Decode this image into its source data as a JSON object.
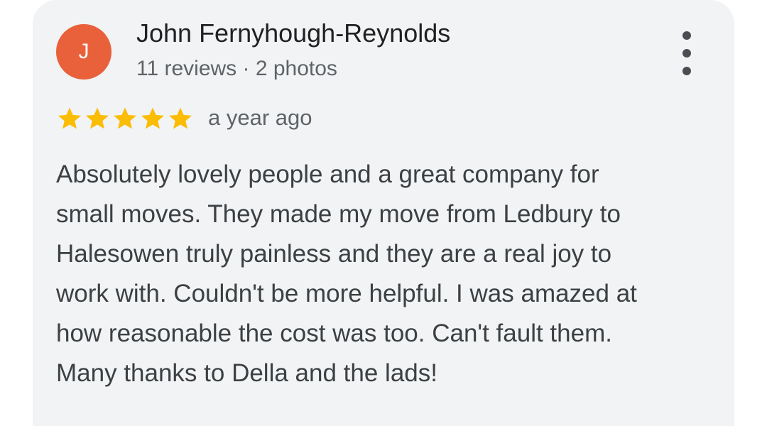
{
  "review": {
    "avatar_initial": "J",
    "author_name": "John Fernyhough-Reynolds",
    "author_meta": "11 reviews · 2 photos",
    "rating": 5,
    "rating_max": 5,
    "time_ago": "a year ago",
    "text_lines": [
      "Absolutely lovely people and a great company for",
      "small moves. They made my move from Ledbury to",
      "Halesowen truly painless and they are a real joy to",
      "work with. Couldn't be more helpful. I was amazed at",
      "how reasonable the cost was too. Can't fault them.",
      "Many thanks to Della and the lads!"
    ]
  },
  "icons": {
    "menu": "more-vert-icon",
    "star": "star-icon"
  },
  "colors": {
    "card_background": "#f1f3f4",
    "avatar_background": "#e8613a",
    "star": "#fbbc04",
    "name_text": "#202124",
    "secondary_text": "#5f6368",
    "body_text": "#3c4043"
  }
}
